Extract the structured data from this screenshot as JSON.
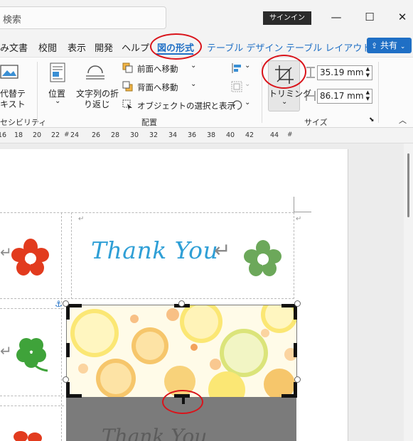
{
  "titlebar": {
    "search_placeholder": "検索",
    "signin_label": "サインイン",
    "minimize": "—",
    "maximize": "☐",
    "close": "✕"
  },
  "tabs": [
    {
      "label": "み文書"
    },
    {
      "label": "校閲"
    },
    {
      "label": "表示"
    },
    {
      "label": "開発"
    },
    {
      "label": "ヘルプ"
    },
    {
      "label": "図の形式"
    },
    {
      "label": "テーブル デザイン"
    },
    {
      "label": "テーブル レイアウト"
    }
  ],
  "share_label": "共有",
  "ribbon": {
    "alt_text_line1": "代替テ",
    "alt_text_line2": "キスト",
    "accessibility_label": "セシビリティ",
    "position_label": "位置",
    "wrap_line1": "文字列の折",
    "wrap_line2": "り返し",
    "bring_forward": "前面へ移動",
    "send_backward": "背面へ移動",
    "selection_pane": "オブジェクトの選択と表示",
    "arrange_group": "配置",
    "crop_label": "トリミング",
    "height_value": "35.19 mm",
    "width_value": "86.17 mm",
    "size_group": "サイズ"
  },
  "ruler": {
    "numbers": [
      "16",
      "18",
      "20",
      "22",
      "24",
      "26",
      "28",
      "30",
      "32",
      "34",
      "36",
      "38",
      "40",
      "42",
      "44"
    ]
  },
  "document": {
    "thank_you": "Thank You",
    "ghost_text": "Thank You"
  }
}
